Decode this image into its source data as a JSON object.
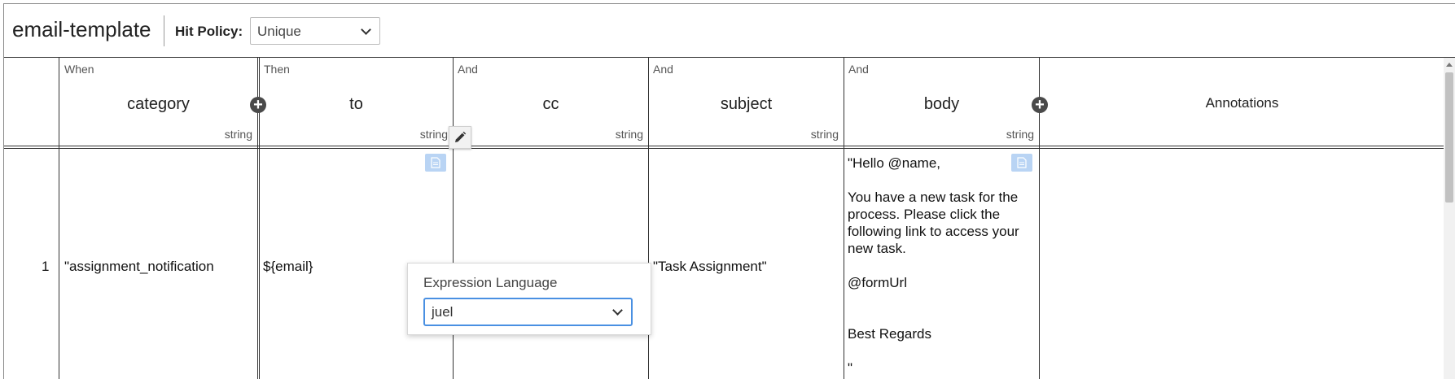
{
  "header": {
    "title": "email-template",
    "hit_policy_label": "Hit Policy:",
    "hit_policy_value": "Unique"
  },
  "columns": [
    {
      "type": "When",
      "name": "category",
      "dtype": "string"
    },
    {
      "type": "Then",
      "name": "to",
      "dtype": "string"
    },
    {
      "type": "And",
      "name": "cc",
      "dtype": "string"
    },
    {
      "type": "And",
      "name": "subject",
      "dtype": "string"
    },
    {
      "type": "And",
      "name": "body",
      "dtype": "string"
    },
    {
      "type": "",
      "name": "Annotations",
      "dtype": ""
    }
  ],
  "row": {
    "number": "1",
    "category": "\"assignment_notification",
    "to": "${email}",
    "cc": "",
    "subject": "\"Task Assignment\"",
    "body": "\"Hello @name,\n\nYou have a new task for the process. Please click the following link to access your new task.\n\n@formUrl\n\n\nBest Regards\n\n\""
  },
  "popup": {
    "label": "Expression Language",
    "value": "juel"
  },
  "icons": {
    "add": "plus-circle-icon",
    "edit": "pencil-icon",
    "doc": "document-icon"
  }
}
